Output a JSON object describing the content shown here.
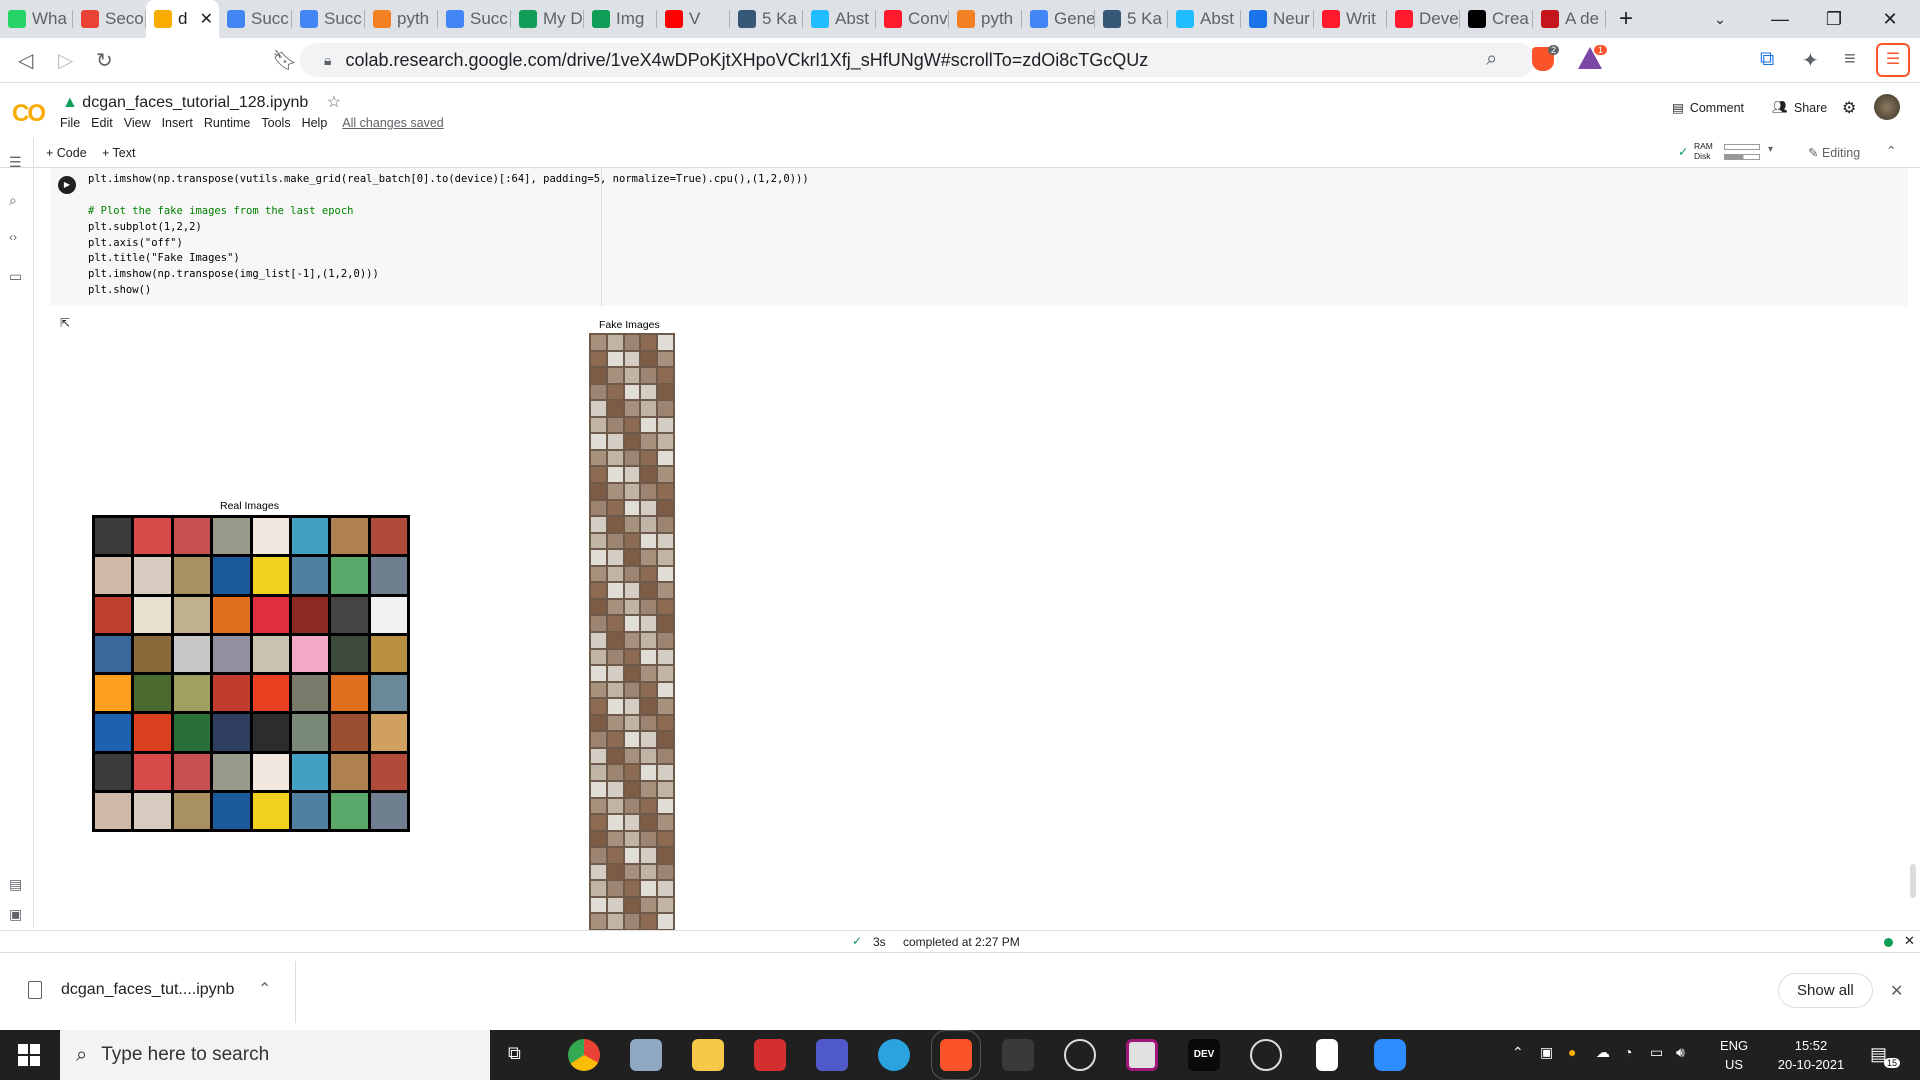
{
  "browser": {
    "tabs": [
      {
        "label": "Wha",
        "fav": "whatsapp-icon",
        "color": "#25d366"
      },
      {
        "label": "Seco",
        "fav": "gmail-icon",
        "color": "#ea4335"
      },
      {
        "label": "d",
        "fav": "colab-icon",
        "color": "#f9ab00",
        "active": true
      },
      {
        "label": "Succ",
        "fav": "google-icon",
        "color": "#4285f4"
      },
      {
        "label": "Succ",
        "fav": "google-icon",
        "color": "#4285f4"
      },
      {
        "label": "pyth",
        "fav": "stackoverflow-icon",
        "color": "#f48024"
      },
      {
        "label": "Succ",
        "fav": "google-icon",
        "color": "#4285f4"
      },
      {
        "label": "My D",
        "fav": "drive-icon",
        "color": "#0f9d58"
      },
      {
        "label": "Img",
        "fav": "drive-icon",
        "color": "#0f9d58"
      },
      {
        "label": "V",
        "fav": "youtube-icon",
        "color": "#ff0000"
      },
      {
        "label": "5 Ka",
        "fav": "tds-icon",
        "color": "#355876"
      },
      {
        "label": "Abst",
        "fav": "kaggle-icon",
        "color": "#20beff"
      },
      {
        "label": "Conv",
        "fav": "opera-icon",
        "color": "#ff1b2d"
      },
      {
        "label": "pyth",
        "fav": "stackoverflow-icon",
        "color": "#f48024"
      },
      {
        "label": "Gene",
        "fav": "google-icon",
        "color": "#4285f4"
      },
      {
        "label": "5 Ka",
        "fav": "tds-icon",
        "color": "#355876"
      },
      {
        "label": "Abst",
        "fav": "kaggle-icon",
        "color": "#20beff"
      },
      {
        "label": "Neur",
        "fav": "profile-icon",
        "color": "#1a73e8"
      },
      {
        "label": "Writ",
        "fav": "opera-icon",
        "color": "#ff1b2d"
      },
      {
        "label": "Deve",
        "fav": "opera-icon",
        "color": "#ff1b2d"
      },
      {
        "label": "Crea",
        "fav": "medium-icon",
        "color": "#000000"
      },
      {
        "label": "A de",
        "fav": "scribd-icon",
        "color": "#c4161c"
      }
    ],
    "url": "colab.research.google.com/drive/1veX4wDPoKjtXHpoVCkrl1Xfj_sHfUNgW#scrollTo=zdOi8cTGcQUz",
    "brave_badge": "2",
    "alert_badge": "1"
  },
  "colab": {
    "notebook_title": "dcgan_faces_tutorial_128.ipynb",
    "menu": [
      "File",
      "Edit",
      "View",
      "Insert",
      "Runtime",
      "Tools",
      "Help"
    ],
    "saved_status": "All changes saved",
    "comment_label": "Comment",
    "share_label": "Share",
    "add_code_label": "+ Code",
    "add_text_label": "+ Text",
    "ram_label": "RAM",
    "disk_label": "Disk",
    "editing_label": "Editing"
  },
  "cell": {
    "code_lines": [
      "plt.imshow(np.transpose(vutils.make_grid(real_batch[0].to(device)[:64], padding=5, normalize=True).cpu(),(1,2,0)))",
      "",
      "# Plot the fake images from the last epoch",
      "plt.subplot(1,2,2)",
      "plt.axis(\"off\")",
      "plt.title(\"Fake Images\")",
      "plt.imshow(np.transpose(img_list[-1],(1,2,0)))",
      "plt.show()"
    ]
  },
  "output": {
    "real_title": "Real Images",
    "fake_title": "Fake Images"
  },
  "status": {
    "duration": "3s",
    "completed": "completed at 2:27 PM"
  },
  "download": {
    "filename": "dcgan_faces_tut....ipynb",
    "show_all": "Show all"
  },
  "taskbar": {
    "search_placeholder": "Type here to search",
    "lang_top": "ENG",
    "lang_bottom": "US",
    "time": "15:52",
    "date": "20-10-2021",
    "notif_count": "15"
  }
}
